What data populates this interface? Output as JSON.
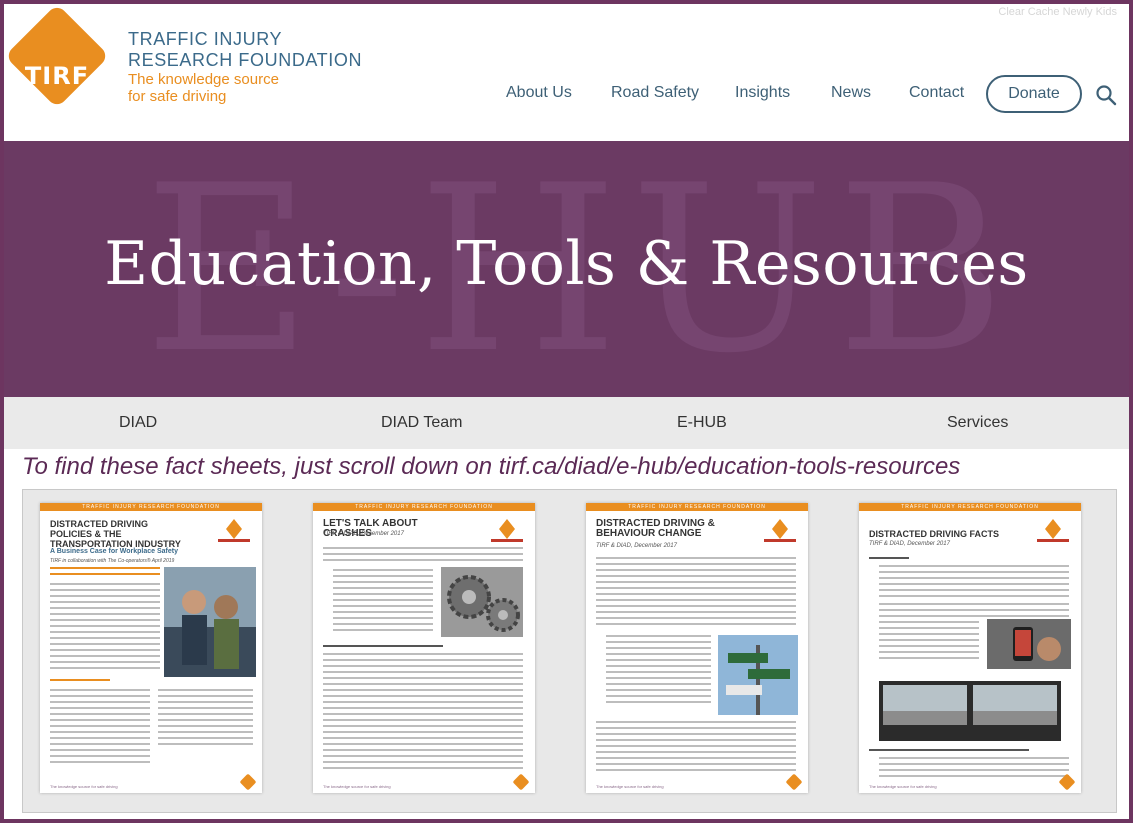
{
  "header": {
    "faint_text": "Clear Cache   Newly Kids",
    "logo_text": "TIRF",
    "org_name_line1": "TRAFFIC INJURY",
    "org_name_line2": "RESEARCH FOUNDATION",
    "tagline_line1": "The knowledge source",
    "tagline_line2": "for safe driving",
    "nav": [
      "About Us",
      "Road Safety",
      "Insights",
      "News",
      "Contact"
    ],
    "donate_label": "Donate",
    "search_icon": "search-icon"
  },
  "hero": {
    "watermark": "E-HUB",
    "title": "Education, Tools & Resources"
  },
  "subnav": [
    "DIAD",
    "DIAD Team",
    "E-HUB",
    "Services"
  ],
  "caption": "To find these fact sheets, just scroll down on tirf.ca/diad/e-hub/education-tools-resources",
  "sheets": [
    {
      "header_bar": "TRAFFIC INJURY RESEARCH FOUNDATION",
      "title": "DISTRACTED DRIVING POLICIES & THE TRANSPORTATION INDUSTRY",
      "subtitle": "A Business Case for Workplace Safety",
      "subtitle2": "TIRF in collaboration with The Co-operators® April 2019",
      "footer": "The knowledge source for safe driving"
    },
    {
      "header_bar": "TRAFFIC INJURY RESEARCH FOUNDATION",
      "title": "LET'S TALK ABOUT CRASHES",
      "subtitle": "TIRF & DIAD, December 2017",
      "footer": "The knowledge source for safe driving"
    },
    {
      "header_bar": "TRAFFIC INJURY RESEARCH FOUNDATION",
      "title": "DISTRACTED DRIVING & BEHAVIOUR CHANGE",
      "subtitle": "TIRF & DIAD, December 2017",
      "footer": "The knowledge source for safe driving"
    },
    {
      "header_bar": "TRAFFIC INJURY RESEARCH FOUNDATION",
      "title": "DISTRACTED DRIVING FACTS",
      "subtitle": "TIRF & DIAD, December 2017",
      "footer": "The knowledge source for safe driving"
    }
  ],
  "colors": {
    "brand_orange": "#e98e20",
    "brand_purple": "#6b3a63",
    "nav_blue": "#3e6076"
  }
}
